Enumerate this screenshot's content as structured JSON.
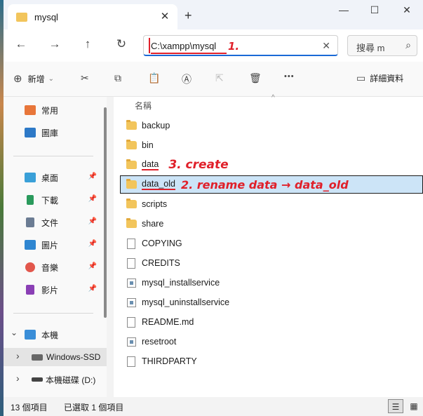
{
  "window": {
    "tab_title": "mysql",
    "close_glyph": "✕",
    "new_tab_glyph": "+",
    "minimize_glyph": "—",
    "maximize_glyph": "☐",
    "window_close_glyph": "✕"
  },
  "nav": {
    "back_glyph": "←",
    "forward_glyph": "→",
    "up_glyph": "↑",
    "refresh_glyph": "↻"
  },
  "address": {
    "path": "C:\\xampp\\mysql",
    "clear_glyph": "✕"
  },
  "search": {
    "placeholder": "搜尋 m",
    "icon_glyph": "⌕"
  },
  "toolbar": {
    "new_label": "新增",
    "new_glyph": "⊕",
    "new_chevron": "⌄",
    "cut_glyph": "✂",
    "copy_glyph": "⧉",
    "paste_glyph": "📋",
    "rename_glyph": "Ⓐ",
    "share_glyph": "⇱",
    "delete_glyph": "🗑",
    "more_glyph": "•••",
    "details_label": "詳細資料",
    "details_glyph": "▭"
  },
  "sidebar": {
    "pin_glyph": "📌",
    "items": [
      {
        "label": "常用",
        "color": "#e8763a"
      },
      {
        "label": "圖庫",
        "color": "#2d79c7"
      },
      {
        "label": "桌面",
        "color": "#3aa0d8"
      },
      {
        "label": "下載",
        "color": "#2a9a5c"
      },
      {
        "label": "文件",
        "color": "#6b7c93"
      },
      {
        "label": "圖片",
        "color": "#2f86d1"
      },
      {
        "label": "音樂",
        "color": "#e2574c"
      },
      {
        "label": "影片",
        "color": "#8a3fb5"
      },
      {
        "label": "本機",
        "color": "#3a8ed8"
      },
      {
        "label": "Windows-SSD",
        "color": "#666666"
      },
      {
        "label": "本機磁碟 (D:)",
        "color": "#444444"
      }
    ],
    "expand_glyph": "›",
    "collapse_glyph": "⌄"
  },
  "main": {
    "column_header": "名稱",
    "sort_glyph": "^",
    "files": [
      {
        "name": "backup",
        "type": "folder"
      },
      {
        "name": "bin",
        "type": "folder"
      },
      {
        "name": "data",
        "type": "folder"
      },
      {
        "name": "data_old",
        "type": "folder",
        "selected": true
      },
      {
        "name": "scripts",
        "type": "folder"
      },
      {
        "name": "share",
        "type": "folder"
      },
      {
        "name": "COPYING",
        "type": "file"
      },
      {
        "name": "CREDITS",
        "type": "file"
      },
      {
        "name": "mysql_installservice",
        "type": "system"
      },
      {
        "name": "mysql_uninstallservice",
        "type": "system"
      },
      {
        "name": "README.md",
        "type": "file"
      },
      {
        "name": "resetroot",
        "type": "system"
      },
      {
        "name": "THIRDPARTY",
        "type": "file"
      }
    ]
  },
  "annotations": {
    "step1": "1.",
    "step2": "2. rename data → data_old",
    "step3": "3. create",
    "color": "#e0202a"
  },
  "status": {
    "count": "13 個項目",
    "selected": "已選取 1 個項目",
    "details_view_glyph": "☰",
    "tiles_view_glyph": "▦"
  }
}
